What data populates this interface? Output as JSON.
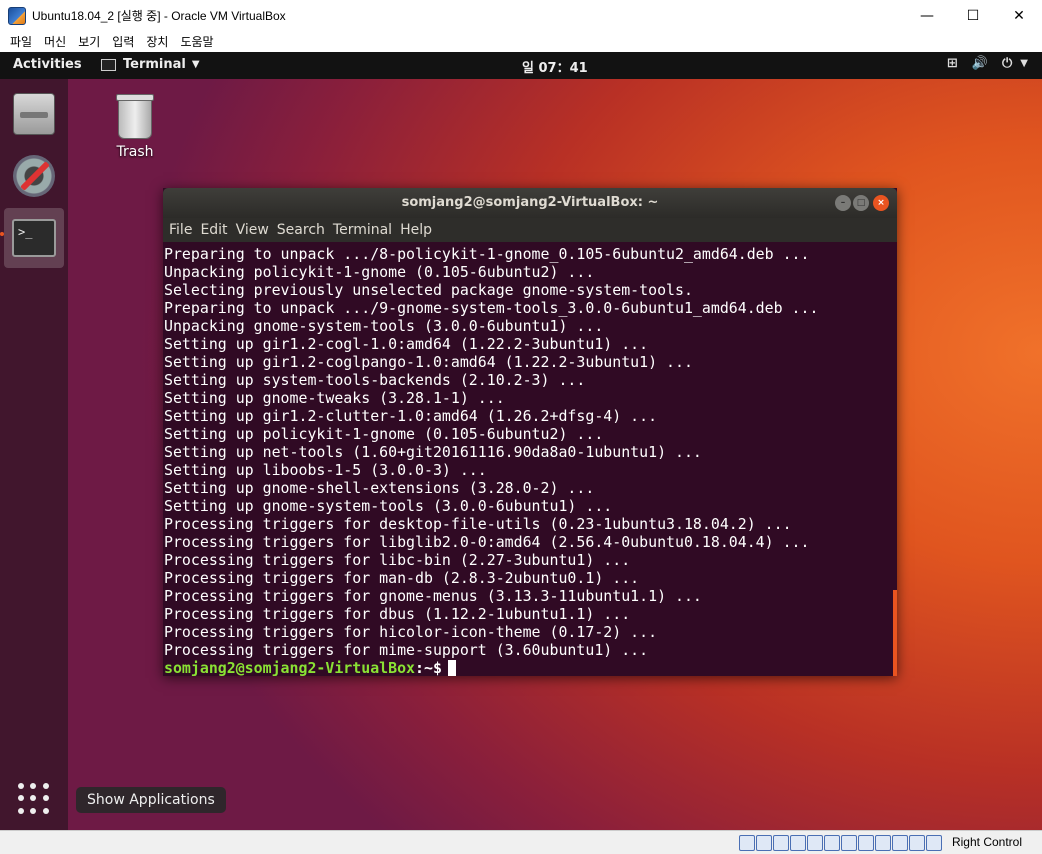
{
  "window": {
    "title": "Ubuntu18.04_2 [실행 중] - Oracle VM VirtualBox",
    "minimize": "—",
    "maximize": "☐",
    "close": "✕"
  },
  "menubar": {
    "items": [
      "파일",
      "머신",
      "보기",
      "입력",
      "장치",
      "도움말"
    ]
  },
  "gnome": {
    "activities": "Activities",
    "app_menu": "Terminal",
    "clock": "일 07：41",
    "tray_icons": [
      "network-icon",
      "volume-icon",
      "power-icon"
    ]
  },
  "desktop": {
    "trash_label": "Trash",
    "show_apps_tooltip": "Show Applications"
  },
  "terminal": {
    "title": "somjang2@somjang2-VirtualBox: ~",
    "menu": [
      "File",
      "Edit",
      "View",
      "Search",
      "Terminal",
      "Help"
    ],
    "lines": [
      "Preparing to unpack .../8-policykit-1-gnome_0.105-6ubuntu2_amd64.deb ...",
      "Unpacking policykit-1-gnome (0.105-6ubuntu2) ...",
      "Selecting previously unselected package gnome-system-tools.",
      "Preparing to unpack .../9-gnome-system-tools_3.0.0-6ubuntu1_amd64.deb ...",
      "Unpacking gnome-system-tools (3.0.0-6ubuntu1) ...",
      "Setting up gir1.2-cogl-1.0:amd64 (1.22.2-3ubuntu1) ...",
      "Setting up gir1.2-coglpango-1.0:amd64 (1.22.2-3ubuntu1) ...",
      "Setting up system-tools-backends (2.10.2-3) ...",
      "Setting up gnome-tweaks (3.28.1-1) ...",
      "Setting up gir1.2-clutter-1.0:amd64 (1.26.2+dfsg-4) ...",
      "Setting up policykit-1-gnome (0.105-6ubuntu2) ...",
      "Setting up net-tools (1.60+git20161116.90da8a0-1ubuntu1) ...",
      "Setting up liboobs-1-5 (3.0.0-3) ...",
      "Setting up gnome-shell-extensions (3.28.0-2) ...",
      "Setting up gnome-system-tools (3.0.0-6ubuntu1) ...",
      "Processing triggers for desktop-file-utils (0.23-1ubuntu3.18.04.2) ...",
      "Processing triggers for libglib2.0-0:amd64 (2.56.4-0ubuntu0.18.04.4) ...",
      "Processing triggers for libc-bin (2.27-3ubuntu1) ...",
      "Processing triggers for man-db (2.8.3-2ubuntu0.1) ...",
      "Processing triggers for gnome-menus (3.13.3-11ubuntu1.1) ...",
      "Processing triggers for dbus (1.12.2-1ubuntu1.1) ...",
      "Processing triggers for hicolor-icon-theme (0.17-2) ...",
      "Processing triggers for mime-support (3.60ubuntu1) ..."
    ],
    "prompt_user": "somjang2@somjang2-VirtualBox",
    "prompt_path": ":~$"
  },
  "statusbar": {
    "host_key": "Right Control"
  },
  "colors": {
    "terminal_bg": "#300a24",
    "prompt_green": "#8ae234",
    "ubuntu_orange": "#e95420"
  }
}
